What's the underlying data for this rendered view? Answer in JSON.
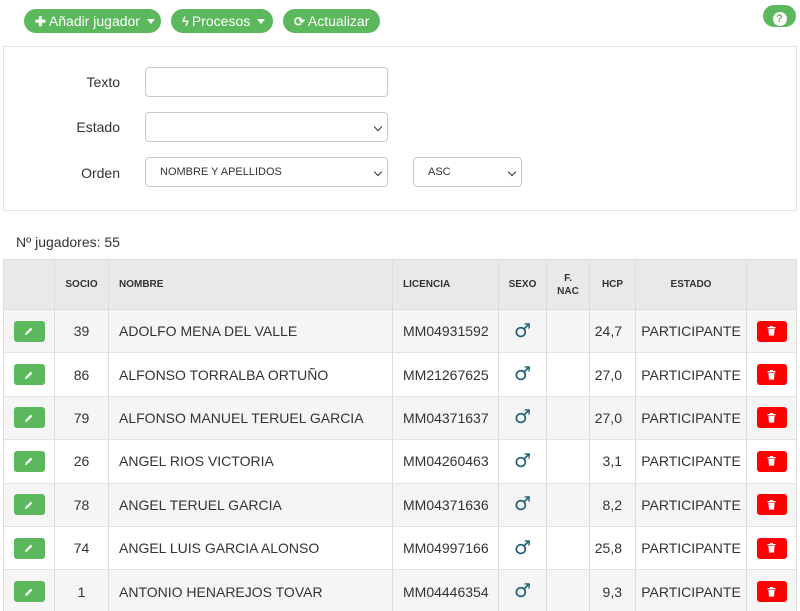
{
  "toolbar": {
    "add_player_label": "Añadir jugador",
    "add_player_icon": "plus-icon",
    "processes_label": "Procesos",
    "processes_icon": "bolt-icon",
    "refresh_label": "Actualizar",
    "refresh_icon": "refresh-icon",
    "help_icon": "question-icon",
    "accent_color": "#5cb85c"
  },
  "filters": {
    "texto_label": "Texto",
    "texto_value": "",
    "estado_label": "Estado",
    "estado_value": "",
    "orden_label": "Orden",
    "orden_value": "NOMBRE Y APELLIDOS",
    "direction_value": "ASC"
  },
  "count_text": "Nº jugadores: 55",
  "table": {
    "headers": {
      "socio": "SOCIO",
      "nombre": "NOMBRE",
      "licencia": "LICENCIA",
      "sexo": "SEXO",
      "fnac_line1": "F.",
      "fnac_line2": "NAC",
      "hcp": "HCP",
      "estado": "ESTADO"
    },
    "rows": [
      {
        "socio": "39",
        "nombre": "ADOLFO MENA DEL VALLE",
        "licencia": "MM04931592",
        "sexo": "♂",
        "fnac": "",
        "hcp": "24,7",
        "estado": "PARTICIPANTE"
      },
      {
        "socio": "86",
        "nombre": "ALFONSO TORRALBA ORTUÑO",
        "licencia": "MM21267625",
        "sexo": "♂",
        "fnac": "",
        "hcp": "27,0",
        "estado": "PARTICIPANTE"
      },
      {
        "socio": "79",
        "nombre": "ALFONSO MANUEL TERUEL GARCIA",
        "licencia": "MM04371637",
        "sexo": "♂",
        "fnac": "",
        "hcp": "27,0",
        "estado": "PARTICIPANTE"
      },
      {
        "socio": "26",
        "nombre": "ANGEL RIOS VICTORIA",
        "licencia": "MM04260463",
        "sexo": "♂",
        "fnac": "",
        "hcp": "3,1",
        "estado": "PARTICIPANTE"
      },
      {
        "socio": "78",
        "nombre": "ANGEL TERUEL GARCIA",
        "licencia": "MM04371636",
        "sexo": "♂",
        "fnac": "",
        "hcp": "8,2",
        "estado": "PARTICIPANTE"
      },
      {
        "socio": "74",
        "nombre": "ANGEL LUIS GARCIA ALONSO",
        "licencia": "MM04997166",
        "sexo": "♂",
        "fnac": "",
        "hcp": "25,8",
        "estado": "PARTICIPANTE"
      },
      {
        "socio": "1",
        "nombre": "ANTONIO HENAREJOS TOVAR",
        "licencia": "MM04446354",
        "sexo": "♂",
        "fnac": "",
        "hcp": "9,3",
        "estado": "PARTICIPANTE"
      }
    ],
    "edit_icon": "pencil-icon",
    "delete_icon": "trash-icon",
    "delete_color": "#ff0000"
  }
}
